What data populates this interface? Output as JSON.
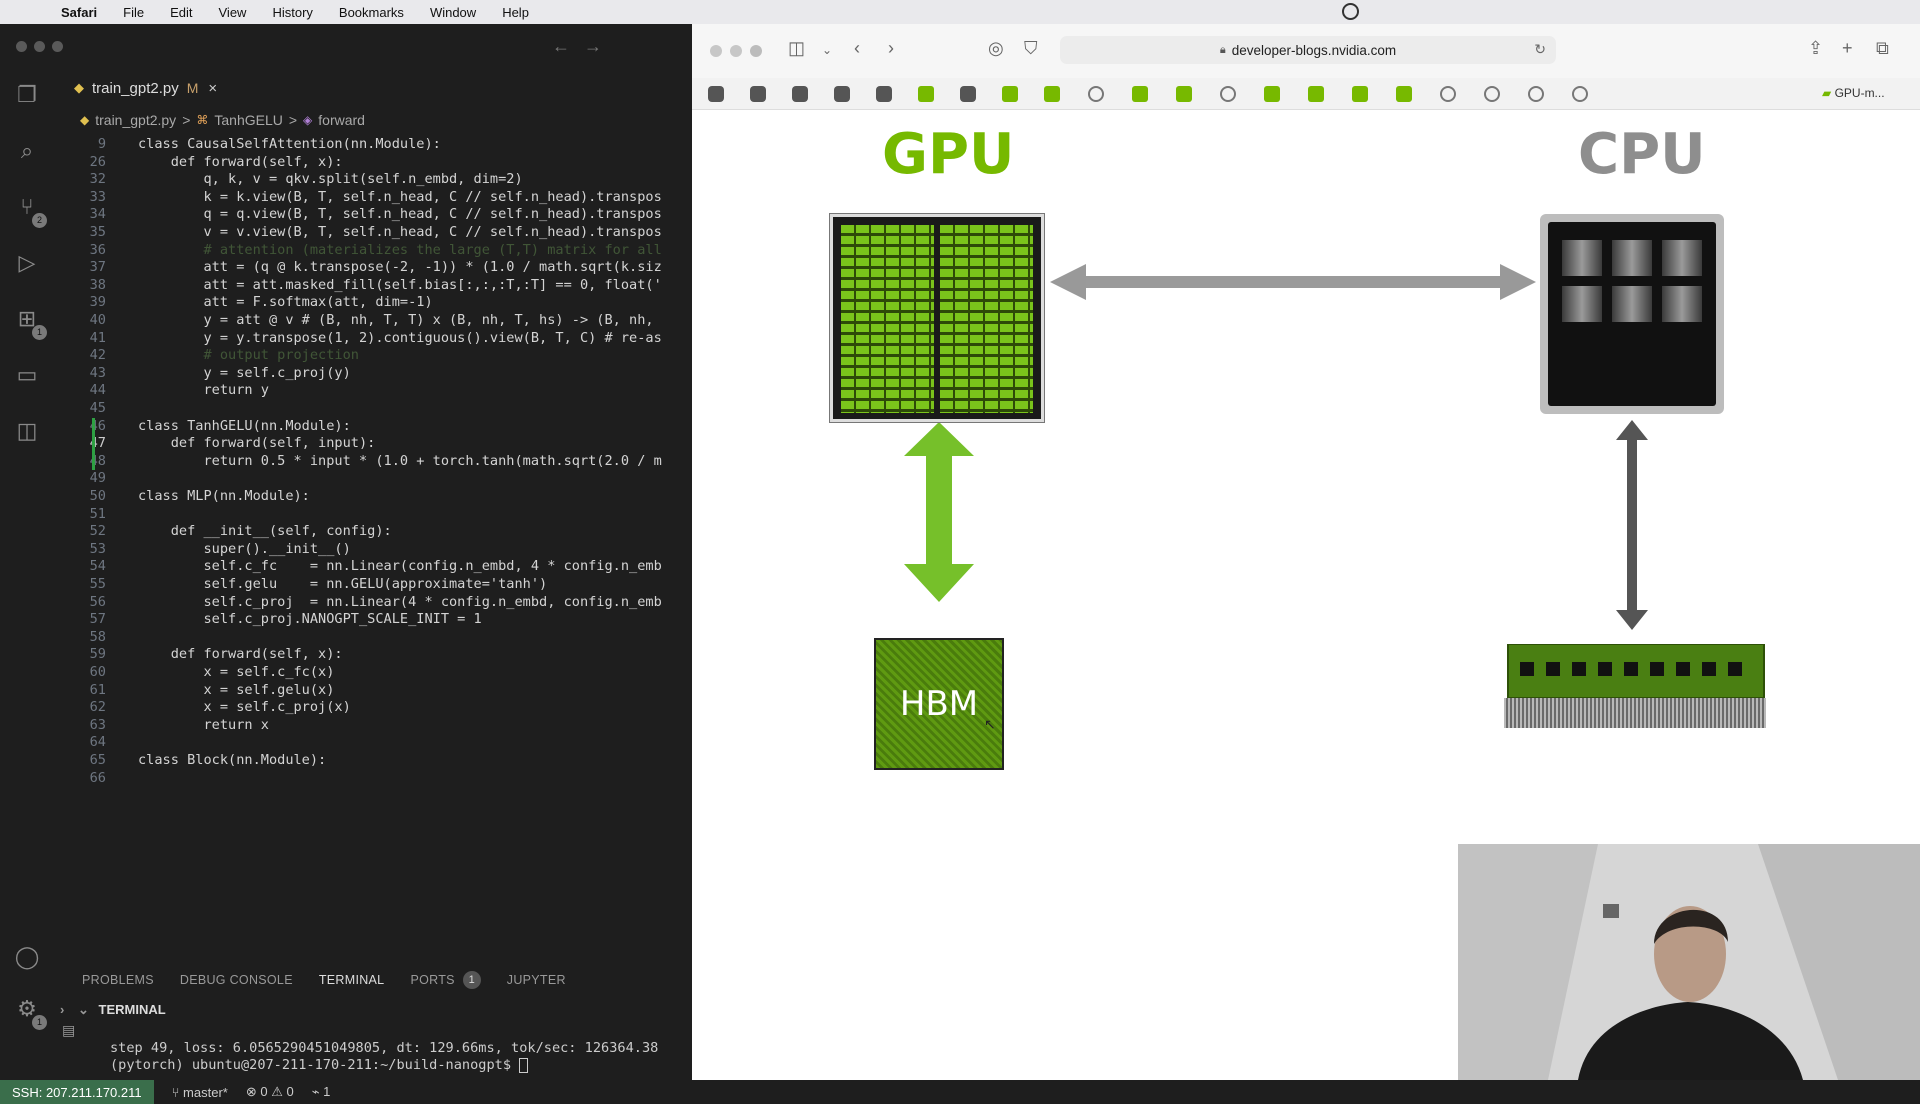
{
  "menubar": {
    "app": "Safari",
    "items": [
      "File",
      "Edit",
      "View",
      "History",
      "Bookmarks",
      "Window",
      "Help"
    ]
  },
  "vscode": {
    "tab": {
      "filename": "train_gpt2.py",
      "modified": "M",
      "close": "×"
    },
    "breadcrumb": {
      "file": "train_gpt2.py",
      "class": "TanhGELU",
      "method": "forward",
      "sep": ">"
    },
    "code": [
      {
        "n": "9",
        "t": "class CausalSelfAttention(nn.Module):"
      },
      {
        "n": "26",
        "t": "    def forward(self, x):"
      },
      {
        "n": "32",
        "t": "        q, k, v = qkv.split(self.n_embd, dim=2)"
      },
      {
        "n": "33",
        "t": "        k = k.view(B, T, self.n_head, C // self.n_head).transpos"
      },
      {
        "n": "34",
        "t": "        q = q.view(B, T, self.n_head, C // self.n_head).transpos"
      },
      {
        "n": "35",
        "t": "        v = v.view(B, T, self.n_head, C // self.n_head).transpos"
      },
      {
        "n": "36",
        "t": "        # attention (materializes the large (T,T) matrix for all"
      },
      {
        "n": "37",
        "t": "        att = (q @ k.transpose(-2, -1)) * (1.0 / math.sqrt(k.siz"
      },
      {
        "n": "38",
        "t": "        att = att.masked_fill(self.bias[:,:,:T,:T] == 0, float('"
      },
      {
        "n": "39",
        "t": "        att = F.softmax(att, dim=-1)"
      },
      {
        "n": "40",
        "t": "        y = att @ v # (B, nh, T, T) x (B, nh, T, hs) -> (B, nh,"
      },
      {
        "n": "41",
        "t": "        y = y.transpose(1, 2).contiguous().view(B, T, C) # re-as"
      },
      {
        "n": "42",
        "t": "        # output projection"
      },
      {
        "n": "43",
        "t": "        y = self.c_proj(y)"
      },
      {
        "n": "44",
        "t": "        return y"
      },
      {
        "n": "45",
        "t": ""
      },
      {
        "n": "46",
        "t": "class TanhGELU(nn.Module):"
      },
      {
        "n": "47",
        "t": "    def forward(self, input):"
      },
      {
        "n": "48",
        "t": "        return 0.5 * input * (1.0 + torch.tanh(math.sqrt(2.0 / m"
      },
      {
        "n": "49",
        "t": ""
      },
      {
        "n": "50",
        "t": "class MLP(nn.Module):"
      },
      {
        "n": "51",
        "t": ""
      },
      {
        "n": "52",
        "t": "    def __init__(self, config):"
      },
      {
        "n": "53",
        "t": "        super().__init__()"
      },
      {
        "n": "54",
        "t": "        self.c_fc    = nn.Linear(config.n_embd, 4 * config.n_emb"
      },
      {
        "n": "55",
        "t": "        self.gelu    = nn.GELU(approximate='tanh')"
      },
      {
        "n": "56",
        "t": "        self.c_proj  = nn.Linear(4 * config.n_embd, config.n_emb"
      },
      {
        "n": "57",
        "t": "        self.c_proj.NANOGPT_SCALE_INIT = 1"
      },
      {
        "n": "58",
        "t": ""
      },
      {
        "n": "59",
        "t": "    def forward(self, x):"
      },
      {
        "n": "60",
        "t": "        x = self.c_fc(x)"
      },
      {
        "n": "61",
        "t": "        x = self.gelu(x)"
      },
      {
        "n": "62",
        "t": "        x = self.c_proj(x)"
      },
      {
        "n": "63",
        "t": "        return x"
      },
      {
        "n": "64",
        "t": ""
      },
      {
        "n": "65",
        "t": "class Block(nn.Module):"
      },
      {
        "n": "66",
        "t": ""
      }
    ],
    "panel": {
      "tabs": [
        "PROBLEMS",
        "DEBUG CONSOLE",
        "TERMINAL",
        "PORTS",
        "JUPYTER"
      ],
      "ports_badge": "1",
      "terminal_title": "TERMINAL"
    },
    "terminal": {
      "line1": "step 49, loss: 6.0565290451049805, dt: 129.66ms, tok/sec: 126364.38",
      "line2": "(pytorch) ubuntu@207-211-170-211:~/build-nanogpt$ "
    },
    "status": {
      "remote": "SSH: 207.211.170.211",
      "branch": "master*",
      "problems": "⊗ 0 ⚠ 0",
      "ports": "1"
    },
    "badges": {
      "scm": "2",
      "extensions": "1",
      "settings": "1"
    }
  },
  "safari": {
    "url": "developer-blogs.nvidia.com",
    "last_tab": "GPU-m...",
    "diagram": {
      "gpu_label": "GPU",
      "cpu_label": "CPU",
      "hbm_label": "HBM"
    },
    "colors": {
      "nvidia_green": "#76b900",
      "gray": "#8e8e8e"
    }
  }
}
